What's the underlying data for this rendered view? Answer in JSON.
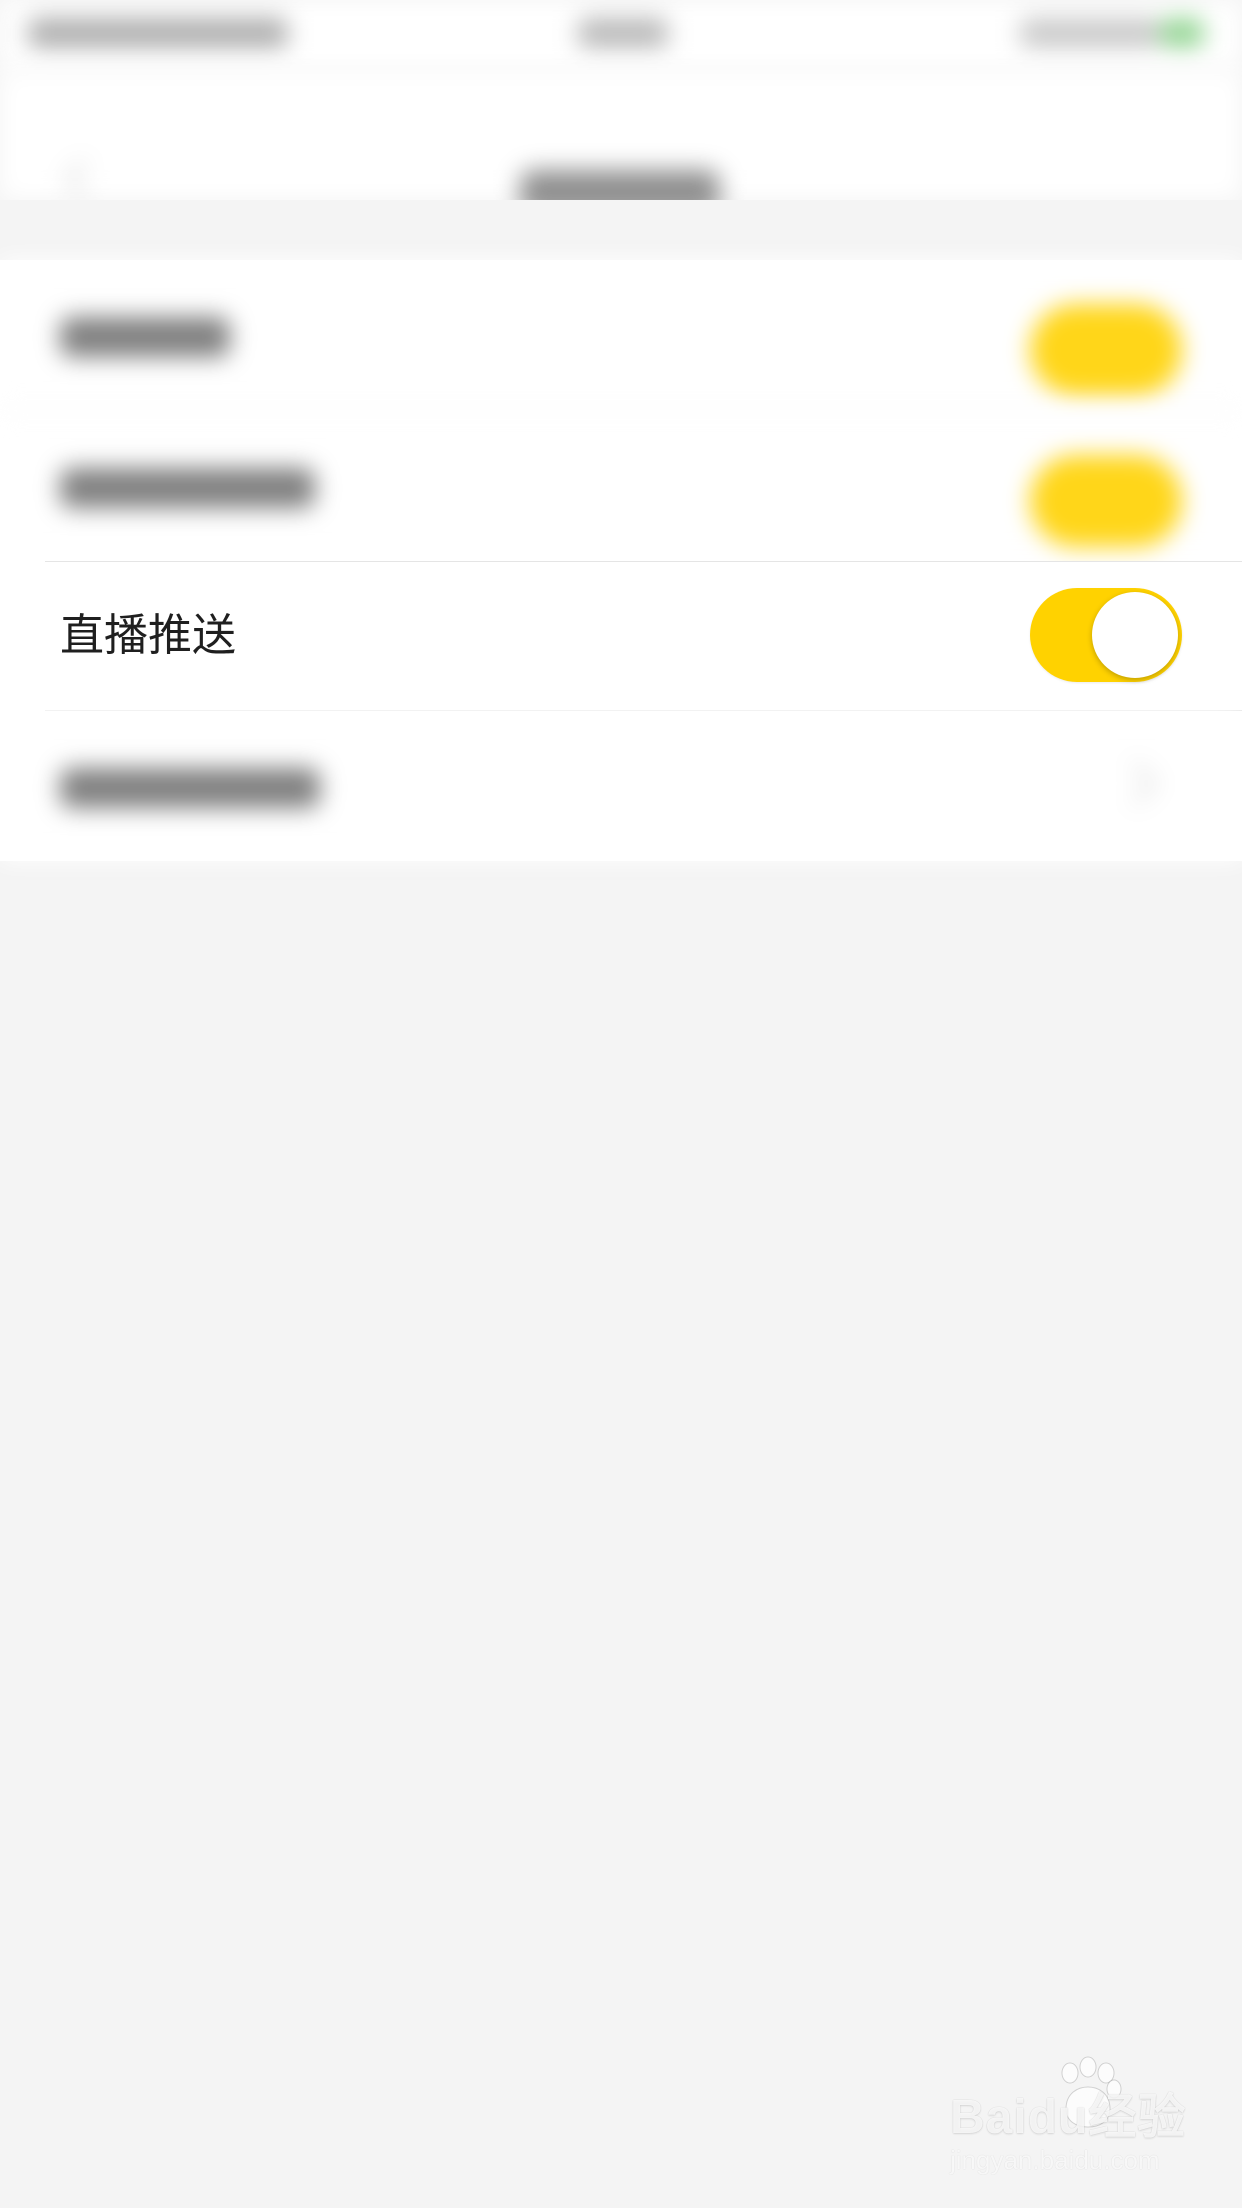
{
  "list": {
    "live_push_label": "直播推送",
    "live_push_enabled": true
  },
  "colors": {
    "accent": "#ffd200",
    "background": "#f4f4f4",
    "row_bg": "#ffffff",
    "text": "#1f1f1f"
  },
  "watermark": {
    "logo_text": "Baidu经验",
    "url_text": "jingyan.baidu.com"
  }
}
